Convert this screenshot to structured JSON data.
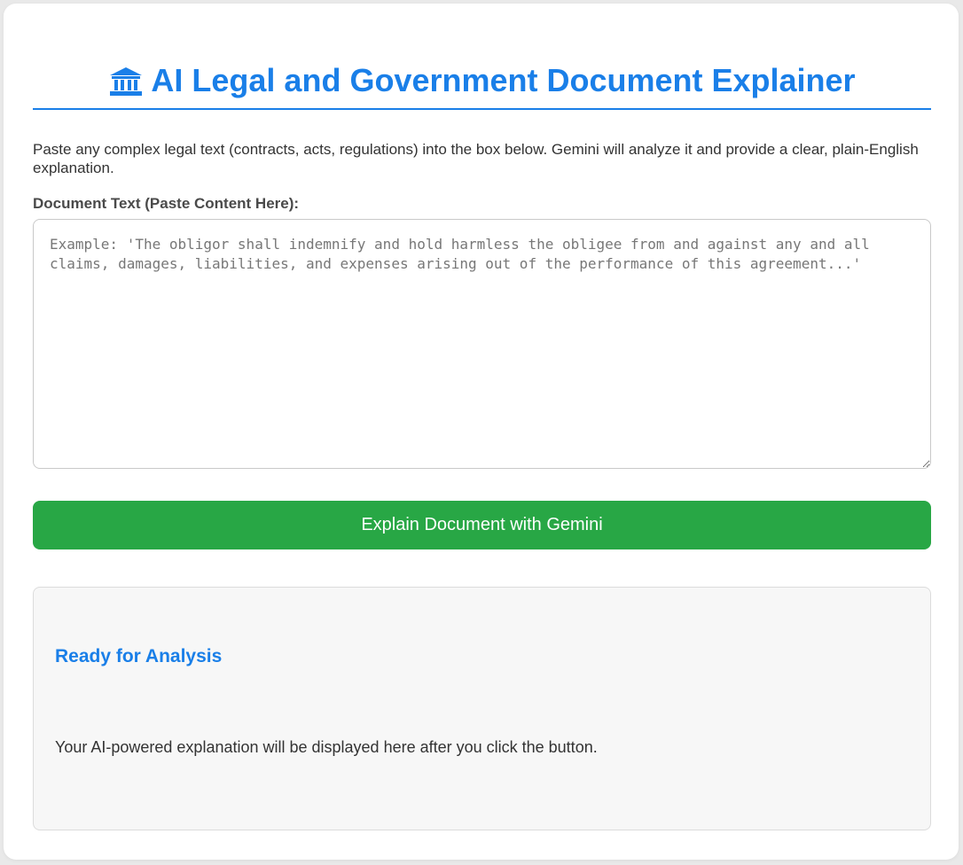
{
  "header": {
    "icon": "government-building-icon",
    "title": "AI Legal and Government Document Explainer"
  },
  "intro": {
    "text": "Paste any complex legal text (contracts, acts, regulations) into the box below. Gemini will analyze it and provide a clear, plain-English explanation."
  },
  "document_input": {
    "label": "Document Text (Paste Content Here):",
    "value": "",
    "placeholder": "Example: 'The obligor shall indemnify and hold harmless the obligee from and against any and all claims, damages, liabilities, and expenses arising out of the performance of this agreement...'"
  },
  "actions": {
    "explain_label": "Explain Document with Gemini"
  },
  "result": {
    "title": "Ready for Analysis",
    "message": "Your AI-powered explanation will be displayed here after you click the button."
  },
  "colors": {
    "accent": "#1a7fe8",
    "button": "#28a745",
    "panel_background": "#f7f7f7"
  }
}
